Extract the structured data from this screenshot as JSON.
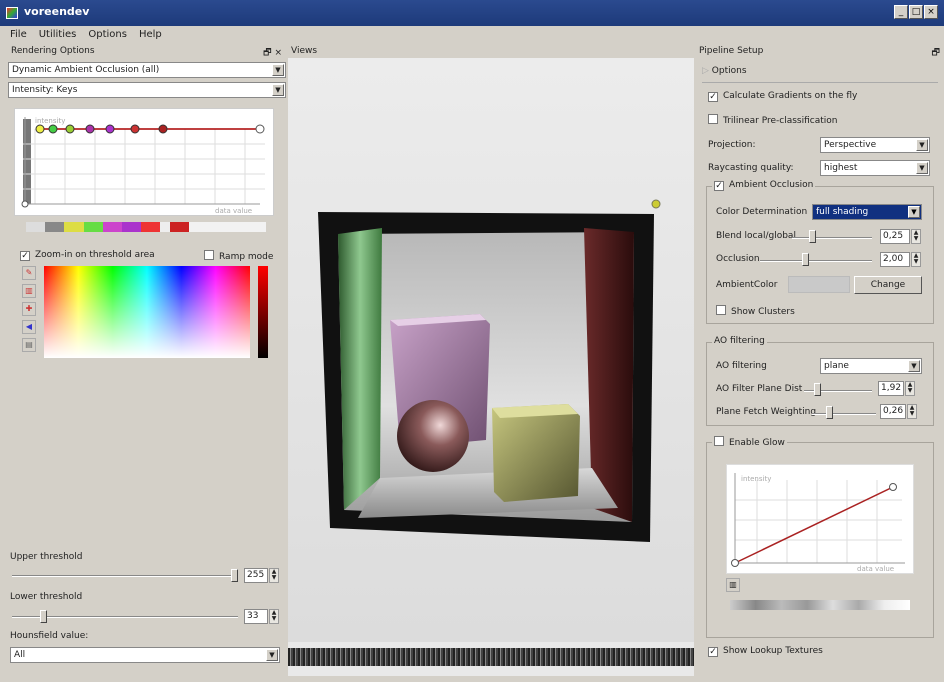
{
  "window": {
    "title": "voreendev",
    "buttons": [
      "_",
      "□",
      "×"
    ]
  },
  "menu": [
    "File",
    "Utilities",
    "Options",
    "Help"
  ],
  "left": {
    "header": "Rendering Options",
    "header_icons": "🗗 ×",
    "mode_combo": "Dynamic Ambient Occlusion (all)",
    "channel_combo": "Intensity: Keys",
    "tf_y_label": "intensity",
    "tf_x_label": "data value",
    "zoom_label": "Zoom-in on threshold area",
    "ramp_label": "Ramp mode",
    "upper_label": "Upper threshold",
    "upper_value": "255",
    "upper_fraction": 1.0,
    "lower_label": "Lower threshold",
    "lower_value": "33",
    "lower_fraction": 0.13,
    "hounsfield_label": "Hounsfield value:",
    "hounsfield_combo": "All"
  },
  "views": {
    "header": "Views"
  },
  "right": {
    "header": "Pipeline Setup",
    "header_icon": "🗗",
    "options_tab": "Options",
    "calc_gradients": "Calculate Gradients on the fly",
    "trilinear": "Trilinear Pre-classification",
    "projection_label": "Projection:",
    "projection_value": "Perspective",
    "quality_label": "Raycasting quality:",
    "quality_value": "highest",
    "ao_group": "Ambient Occlusion",
    "color_det_label": "Color Determination",
    "color_det_value": "full shading",
    "blend_label": "Blend local/global",
    "blend_value": "0,25",
    "occlusion_label": "Occlusion",
    "occlusion_value": "2,00",
    "ambient_color_label": "AmbientColor",
    "change_button": "Change",
    "show_clusters": "Show Clusters",
    "aof_group": "AO filtering",
    "aof_label": "AO filtering",
    "aof_value": "plane",
    "plane_dist_label": "AO Filter Plane Dist",
    "plane_dist_value": "1,92",
    "plane_fetch_label": "Plane Fetch Weighting",
    "plane_fetch_value": "0,26",
    "glow_label": "Enable Glow",
    "glow_y_label": "intensity",
    "glow_x_label": "data value",
    "show_lookup": "Show Lookup Textures"
  },
  "icons": [
    "picker-icon",
    "histogram-icon",
    "eyedropper-icon",
    "arrow-icon",
    "save-icon"
  ]
}
